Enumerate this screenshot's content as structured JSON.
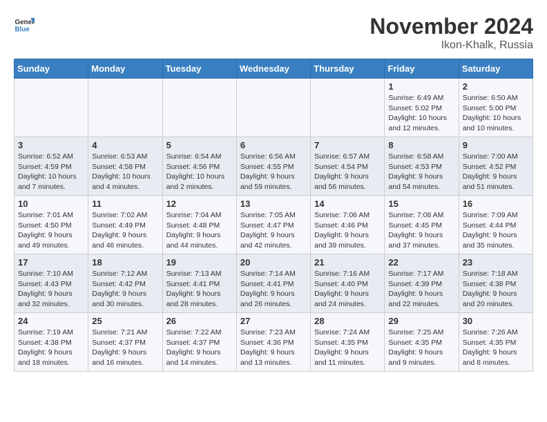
{
  "header": {
    "logo_line1": "General",
    "logo_line2": "Blue",
    "month": "November 2024",
    "location": "Ikon-Khalk, Russia"
  },
  "weekdays": [
    "Sunday",
    "Monday",
    "Tuesday",
    "Wednesday",
    "Thursday",
    "Friday",
    "Saturday"
  ],
  "weeks": [
    [
      {
        "day": "",
        "info": ""
      },
      {
        "day": "",
        "info": ""
      },
      {
        "day": "",
        "info": ""
      },
      {
        "day": "",
        "info": ""
      },
      {
        "day": "",
        "info": ""
      },
      {
        "day": "1",
        "info": "Sunrise: 6:49 AM\nSunset: 5:02 PM\nDaylight: 10 hours and 12 minutes."
      },
      {
        "day": "2",
        "info": "Sunrise: 6:50 AM\nSunset: 5:00 PM\nDaylight: 10 hours and 10 minutes."
      }
    ],
    [
      {
        "day": "3",
        "info": "Sunrise: 6:52 AM\nSunset: 4:59 PM\nDaylight: 10 hours and 7 minutes."
      },
      {
        "day": "4",
        "info": "Sunrise: 6:53 AM\nSunset: 4:58 PM\nDaylight: 10 hours and 4 minutes."
      },
      {
        "day": "5",
        "info": "Sunrise: 6:54 AM\nSunset: 4:56 PM\nDaylight: 10 hours and 2 minutes."
      },
      {
        "day": "6",
        "info": "Sunrise: 6:56 AM\nSunset: 4:55 PM\nDaylight: 9 hours and 59 minutes."
      },
      {
        "day": "7",
        "info": "Sunrise: 6:57 AM\nSunset: 4:54 PM\nDaylight: 9 hours and 56 minutes."
      },
      {
        "day": "8",
        "info": "Sunrise: 6:58 AM\nSunset: 4:53 PM\nDaylight: 9 hours and 54 minutes."
      },
      {
        "day": "9",
        "info": "Sunrise: 7:00 AM\nSunset: 4:52 PM\nDaylight: 9 hours and 51 minutes."
      }
    ],
    [
      {
        "day": "10",
        "info": "Sunrise: 7:01 AM\nSunset: 4:50 PM\nDaylight: 9 hours and 49 minutes."
      },
      {
        "day": "11",
        "info": "Sunrise: 7:02 AM\nSunset: 4:49 PM\nDaylight: 9 hours and 46 minutes."
      },
      {
        "day": "12",
        "info": "Sunrise: 7:04 AM\nSunset: 4:48 PM\nDaylight: 9 hours and 44 minutes."
      },
      {
        "day": "13",
        "info": "Sunrise: 7:05 AM\nSunset: 4:47 PM\nDaylight: 9 hours and 42 minutes."
      },
      {
        "day": "14",
        "info": "Sunrise: 7:06 AM\nSunset: 4:46 PM\nDaylight: 9 hours and 39 minutes."
      },
      {
        "day": "15",
        "info": "Sunrise: 7:08 AM\nSunset: 4:45 PM\nDaylight: 9 hours and 37 minutes."
      },
      {
        "day": "16",
        "info": "Sunrise: 7:09 AM\nSunset: 4:44 PM\nDaylight: 9 hours and 35 minutes."
      }
    ],
    [
      {
        "day": "17",
        "info": "Sunrise: 7:10 AM\nSunset: 4:43 PM\nDaylight: 9 hours and 32 minutes."
      },
      {
        "day": "18",
        "info": "Sunrise: 7:12 AM\nSunset: 4:42 PM\nDaylight: 9 hours and 30 minutes."
      },
      {
        "day": "19",
        "info": "Sunrise: 7:13 AM\nSunset: 4:41 PM\nDaylight: 9 hours and 28 minutes."
      },
      {
        "day": "20",
        "info": "Sunrise: 7:14 AM\nSunset: 4:41 PM\nDaylight: 9 hours and 26 minutes."
      },
      {
        "day": "21",
        "info": "Sunrise: 7:16 AM\nSunset: 4:40 PM\nDaylight: 9 hours and 24 minutes."
      },
      {
        "day": "22",
        "info": "Sunrise: 7:17 AM\nSunset: 4:39 PM\nDaylight: 9 hours and 22 minutes."
      },
      {
        "day": "23",
        "info": "Sunrise: 7:18 AM\nSunset: 4:38 PM\nDaylight: 9 hours and 20 minutes."
      }
    ],
    [
      {
        "day": "24",
        "info": "Sunrise: 7:19 AM\nSunset: 4:38 PM\nDaylight: 9 hours and 18 minutes."
      },
      {
        "day": "25",
        "info": "Sunrise: 7:21 AM\nSunset: 4:37 PM\nDaylight: 9 hours and 16 minutes."
      },
      {
        "day": "26",
        "info": "Sunrise: 7:22 AM\nSunset: 4:37 PM\nDaylight: 9 hours and 14 minutes."
      },
      {
        "day": "27",
        "info": "Sunrise: 7:23 AM\nSunset: 4:36 PM\nDaylight: 9 hours and 13 minutes."
      },
      {
        "day": "28",
        "info": "Sunrise: 7:24 AM\nSunset: 4:35 PM\nDaylight: 9 hours and 11 minutes."
      },
      {
        "day": "29",
        "info": "Sunrise: 7:25 AM\nSunset: 4:35 PM\nDaylight: 9 hours and 9 minutes."
      },
      {
        "day": "30",
        "info": "Sunrise: 7:26 AM\nSunset: 4:35 PM\nDaylight: 9 hours and 8 minutes."
      }
    ]
  ]
}
